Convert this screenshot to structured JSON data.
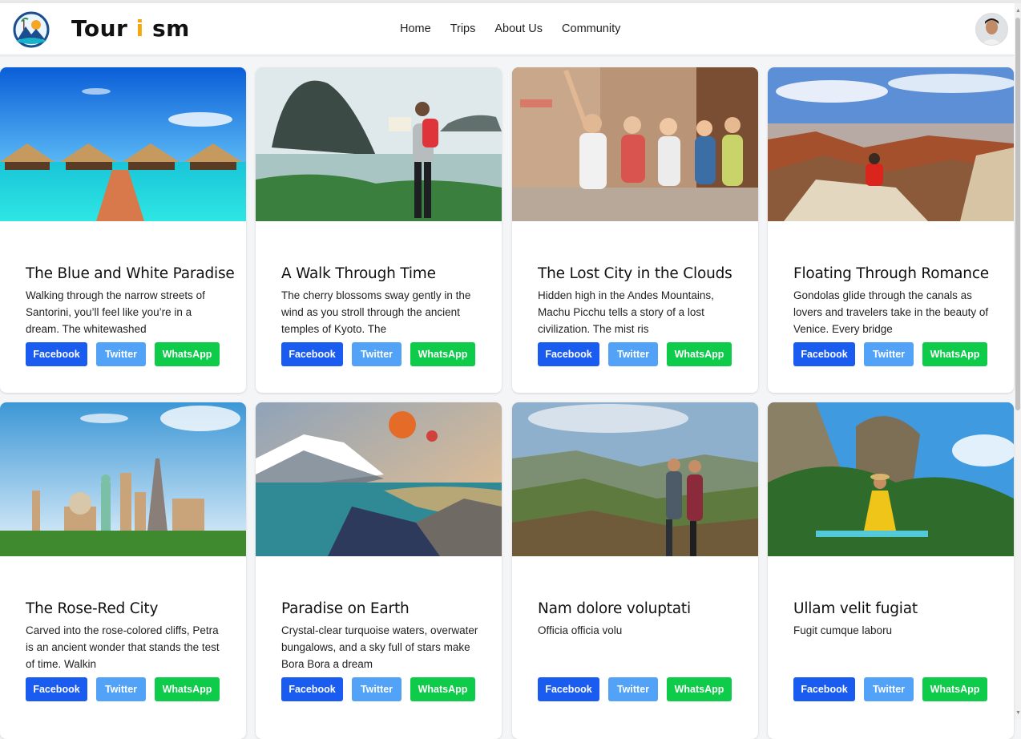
{
  "brand": {
    "name_part1": "Tour",
    "name_accent": "i",
    "name_part2": "sm",
    "accent_color": "#f5a80b"
  },
  "nav": {
    "items": [
      "Home",
      "Trips",
      "About Us",
      "Community"
    ]
  },
  "user": {
    "avatar_icon": "user-avatar"
  },
  "share_buttons": {
    "facebook": {
      "label": "Facebook",
      "color": "#1a5bf0"
    },
    "twitter": {
      "label": "Twitter",
      "color": "#52a3f7"
    },
    "whatsapp": {
      "label": "WhatsApp",
      "color": "#0ecb4a"
    }
  },
  "cards": [
    {
      "title": "The Blue and White Paradise",
      "description": "Walking through the narrow streets of Santorini, you’ll feel like you’re in a dream. The whitewashed",
      "image": "overwater-bungalows"
    },
    {
      "title": "A Walk Through Time",
      "description": "The cherry blossoms sway gently in the wind as you stroll through the ancient temples of Kyoto. The",
      "image": "hiker-coastal-island"
    },
    {
      "title": "The Lost City in the Clouds",
      "description": "Hidden high in the Andes Mountains, Machu Picchu tells a story of a lost civilization. The mist ris",
      "image": "tour-group-street"
    },
    {
      "title": "Floating Through Romance",
      "description": "Gondolas glide through the canals as lovers and travelers take in the beauty of Venice. Every bridge",
      "image": "canyon-viewpoint"
    },
    {
      "title": "The Rose-Red City",
      "description": "Carved into the rose-colored cliffs, Petra is an ancient wonder that stands the test of time. Walkin",
      "image": "world-landmarks"
    },
    {
      "title": "Paradise on Earth",
      "description": "Crystal-clear turquoise waters, overwater bungalows, and a sky full of stars make Bora Bora a dream",
      "image": "balloons-fjord"
    },
    {
      "title": "Nam dolore voluptati",
      "description": "Officia officia volu",
      "image": "couple-valley"
    },
    {
      "title": "Ullam velit fugiat",
      "description": "Fugit cumque laboru",
      "image": "tropical-cliffs"
    }
  ]
}
